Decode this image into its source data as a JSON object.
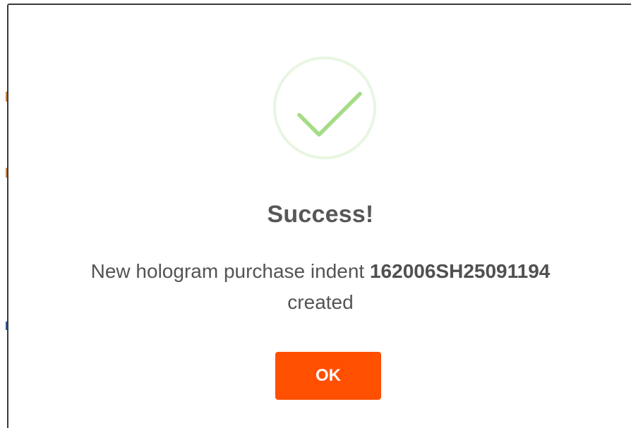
{
  "dialog": {
    "title": "Success!",
    "message_prefix": "New hologram purchase indent ",
    "indent_number": "162006SH25091194",
    "message_suffix": "created",
    "ok_label": "OK",
    "icon": "checkmark-icon"
  },
  "colors": {
    "success_green": "#a5dc86",
    "button_orange": "#ff4f00",
    "text_gray": "#545454"
  }
}
